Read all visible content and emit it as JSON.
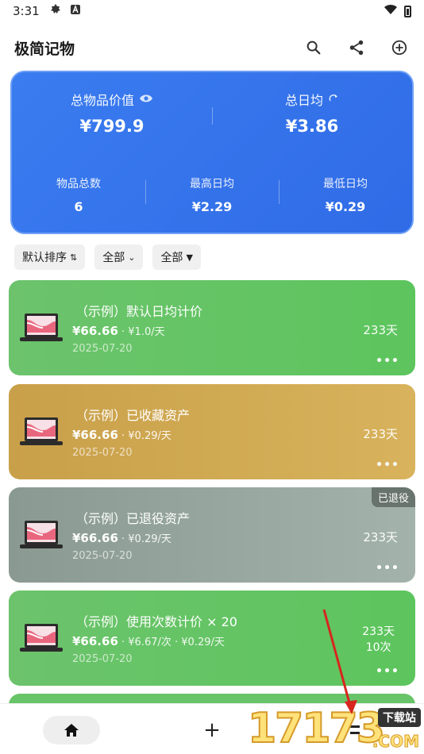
{
  "status": {
    "time": "3:31"
  },
  "app": {
    "title": "极简记物"
  },
  "summary": {
    "total_value_label": "总物品价值",
    "total_value": "¥799.9",
    "daily_avg_label": "总日均",
    "daily_avg": "¥3.86",
    "count_label": "物品总数",
    "count": "6",
    "max_daily_label": "最高日均",
    "max_daily": "¥2.29",
    "min_daily_label": "最低日均",
    "min_daily": "¥0.29"
  },
  "filters": [
    {
      "label": "默认排序",
      "icon": "sort-icon"
    },
    {
      "label": "全部",
      "icon": "chevron-down-icon"
    },
    {
      "label": "全部",
      "icon": "filter-icon"
    }
  ],
  "items": [
    {
      "name": "（示例）默认日均计价",
      "price": "¥66.66",
      "sub": " · ¥1.0/天",
      "date": "2025-07-20",
      "days": "233天",
      "color": "#5dc55d"
    },
    {
      "name": "（示例）已收藏资产",
      "price": "¥66.66",
      "sub": " · ¥0.29/天",
      "date": "2025-07-20",
      "days": "233天",
      "color": "#d0aa55"
    },
    {
      "name": "（示例）已退役资产",
      "price": "¥66.66",
      "sub": " · ¥0.29/天",
      "date": "2025-07-20",
      "days": "233天",
      "badge": "已退役",
      "color": "#96a69e"
    },
    {
      "name": "（示例）使用次数计价 × 20",
      "price": "¥66.66",
      "sub": " · ¥6.67/次 · ¥0.29/天",
      "date": "2025-07-20",
      "days": "233天",
      "uses": "10次",
      "color": "#5dc55d"
    }
  ],
  "more": "•••",
  "nav": {
    "add": "+"
  },
  "watermark": {
    "digits": "17173",
    "tag": "下载站",
    "com": ".COM"
  }
}
